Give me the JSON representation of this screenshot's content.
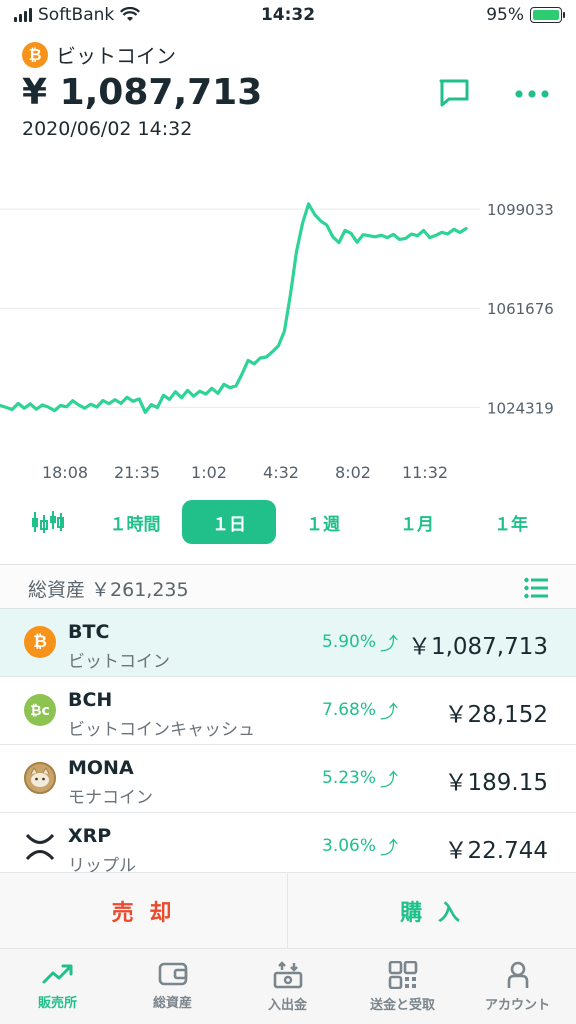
{
  "status_bar": {
    "carrier": "SoftBank",
    "time": "14:32",
    "battery": "95%",
    "battery_level": 0.95
  },
  "header": {
    "coin_name": "ビットコイン",
    "price": "¥ 1,087,713",
    "datetime": "2020/06/02 14:32",
    "chat_icon": "chat-icon",
    "more_icon": "more-icon"
  },
  "chart_data": {
    "type": "line",
    "y_ticks": [
      "1099033",
      "1061676",
      "1024319"
    ],
    "x_ticks": [
      "18:08",
      "21:35",
      "1:02",
      "4:32",
      "8:02",
      "11:32"
    ],
    "ylim": [
      1012000,
      1110000
    ],
    "line_color": "#2ed396",
    "grid": true,
    "series": [
      {
        "values": [
          1025000,
          1024300,
          1023500,
          1025800,
          1024000,
          1025600,
          1023600,
          1025200,
          1024400,
          1023100,
          1025000,
          1024500,
          1026800,
          1025200,
          1024000,
          1025500,
          1024400,
          1026900,
          1025700,
          1027200,
          1025800,
          1028100,
          1026600,
          1027500,
          1022400,
          1025300,
          1024200,
          1028800,
          1027300,
          1030200,
          1027900,
          1030700,
          1028500,
          1030400,
          1029300,
          1031500,
          1029600,
          1033000,
          1031700,
          1032400,
          1036900,
          1042000,
          1040700,
          1042900,
          1043300,
          1045200,
          1047500,
          1053000,
          1067000,
          1083000,
          1093800,
          1101000,
          1097000,
          1094500,
          1093000,
          1088500,
          1086400,
          1091000,
          1089900,
          1086500,
          1089400,
          1089000,
          1088600,
          1089200,
          1088300,
          1089500,
          1087600,
          1088000,
          1089600,
          1089000,
          1091000,
          1088300,
          1089100,
          1090300,
          1089700,
          1091400,
          1090200,
          1091700
        ]
      }
    ]
  },
  "periods": [
    {
      "label": "",
      "icon": "candlestick-icon"
    },
    {
      "label": "１時間"
    },
    {
      "label": "１日",
      "active": true
    },
    {
      "label": "１週"
    },
    {
      "label": "１月"
    },
    {
      "label": "１年"
    }
  ],
  "assets": {
    "label": "総資産 ￥261,235",
    "list_icon": "list-icon"
  },
  "coins": [
    {
      "symbol": "BTC",
      "name": "ビットコイン",
      "change": "5.90%",
      "price": "￥1,087,713",
      "icon": "btc-icon",
      "color": "#f7931a"
    },
    {
      "symbol": "BCH",
      "name": "ビットコインキャッシュ",
      "change": "7.68%",
      "price": "￥28,152",
      "icon": "bch-icon",
      "color": "#8dc351"
    },
    {
      "symbol": "MONA",
      "name": "モナコイン",
      "change": "5.23%",
      "price": "￥189.15",
      "icon": "mona-icon",
      "color": "#c9a46a"
    },
    {
      "symbol": "XRP",
      "name": "リップル",
      "change": "3.06%",
      "price": "￥22.744",
      "icon": "xrp-icon",
      "color": "#23292f"
    }
  ],
  "actions": {
    "sell": "売 却",
    "buy": "購 入"
  },
  "tabs": [
    {
      "label": "販売所",
      "icon": "trend-icon",
      "active": true
    },
    {
      "label": "総資産",
      "icon": "wallet-icon"
    },
    {
      "label": "入出金",
      "icon": "deposit-icon"
    },
    {
      "label": "送金と受取",
      "icon": "qr-icon"
    },
    {
      "label": "アカウント",
      "icon": "person-icon"
    }
  ],
  "colors": {
    "accent": "#21c08b",
    "sell": "#ea4a2e",
    "selected_row": "#e6f7f5"
  }
}
